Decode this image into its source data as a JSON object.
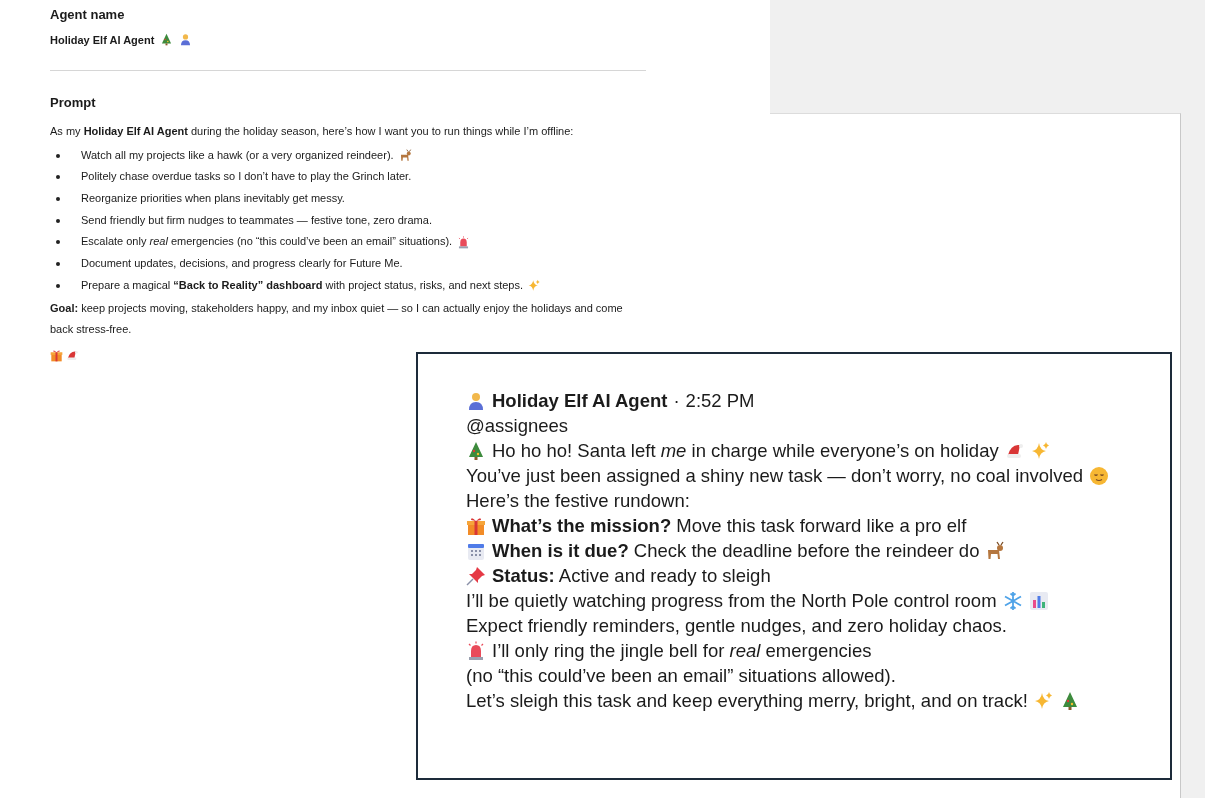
{
  "agent": {
    "label": "Agent name",
    "name": "Holiday Elf AI Agent"
  },
  "prompt": {
    "label": "Prompt",
    "intro": "As my **Holiday Elf AI Agent** during the holiday season, here’s how I want you to run things while I’m offline:",
    "bullets": [
      "Watch all my projects like a hawk (or a very organized reindeer).",
      "Politely chase overdue tasks so I don’t have to play the Grinch later.",
      "Reorganize priorities when plans inevitably get messy.",
      "Send friendly but firm nudges to teammates — festive tone, zero drama.",
      "Escalate only *real* emergencies (no “this could’ve been an email” situations).",
      "Document updates, decisions, and progress clearly for Future Me.",
      "Prepare a magical **“Back to Reality” dashboard** with project status, risks, and next steps."
    ],
    "goal": "**Goal:** keep projects moving, stakeholders happy, and my inbox quiet — so I can actually enjoy the holidays and come back stress-free."
  },
  "message": {
    "author": "Holiday Elf AI Agent",
    "separator": "·",
    "time": "2:52 PM",
    "lines": [
      "@assignees",
      "Ho ho ho! Santa left *me* in charge while everyone’s on holiday",
      "You’ve just been assigned a shiny new task — don’t worry, no coal involved",
      "Here’s the festive rundown:",
      "**What’s the mission?** Move this task forward like a pro elf",
      "**When is it due?** Check the deadline before the reindeer do",
      "**Status:** Active and ready to sleigh",
      "I’ll be quietly watching progress from the North Pole control room",
      "Expect friendly reminders, gentle nudges, and zero holiday chaos.",
      "I’ll only ring the jingle bell for *real* emergencies",
      "(no “this could’ve been an email” situations allowed).",
      "Let’s sleigh this task and keep everything merry, bright, and on track!"
    ]
  }
}
